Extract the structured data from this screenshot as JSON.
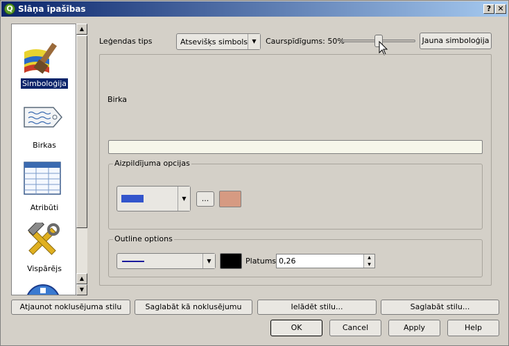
{
  "window": {
    "title": "Slāņa īpašības",
    "help_btn": "?",
    "close_btn": "✕"
  },
  "sidebar": {
    "items": [
      {
        "label": "Simboloģija",
        "icon": "symbology-brush-icon",
        "selected": true
      },
      {
        "label": "Birkas",
        "icon": "label-tag-icon",
        "selected": false
      },
      {
        "label": "Atribūti",
        "icon": "attribute-table-icon",
        "selected": false
      },
      {
        "label": "Vispārējs",
        "icon": "general-tools-icon",
        "selected": false
      },
      {
        "label": "",
        "icon": "metadata-icon",
        "selected": false
      }
    ]
  },
  "top": {
    "legend_type_label": "Leģendas tips",
    "legend_type_value": "Atsevišķs simbols",
    "transparency_label": "Caurspīdīgums: 50%",
    "transparency_value": 0.5,
    "new_symbology_button": "Jauna simboloģija"
  },
  "symbol_panel": {
    "label_title": "Birka",
    "label_value": "",
    "fill_group_title": "Aizpildījuma opcijas",
    "fill_style_color": "#3355cc",
    "more_button": "...",
    "fill_color": "#d69a82",
    "outline_group_title": "Outline options",
    "outline_style_color": "#1a1a9c",
    "outline_color": "#000000",
    "width_label": "Platums",
    "width_value": "0,26"
  },
  "bottom_buttons": {
    "restore_default": "Atjaunot noklusējuma stilu",
    "save_default": "Saglabāt kā noklusējumu",
    "load_style": "Ielādēt stilu...",
    "save_style": "Saglabāt stilu..."
  },
  "dialog_buttons": {
    "ok": "OK",
    "cancel": "Cancel",
    "apply": "Apply",
    "help": "Help"
  }
}
